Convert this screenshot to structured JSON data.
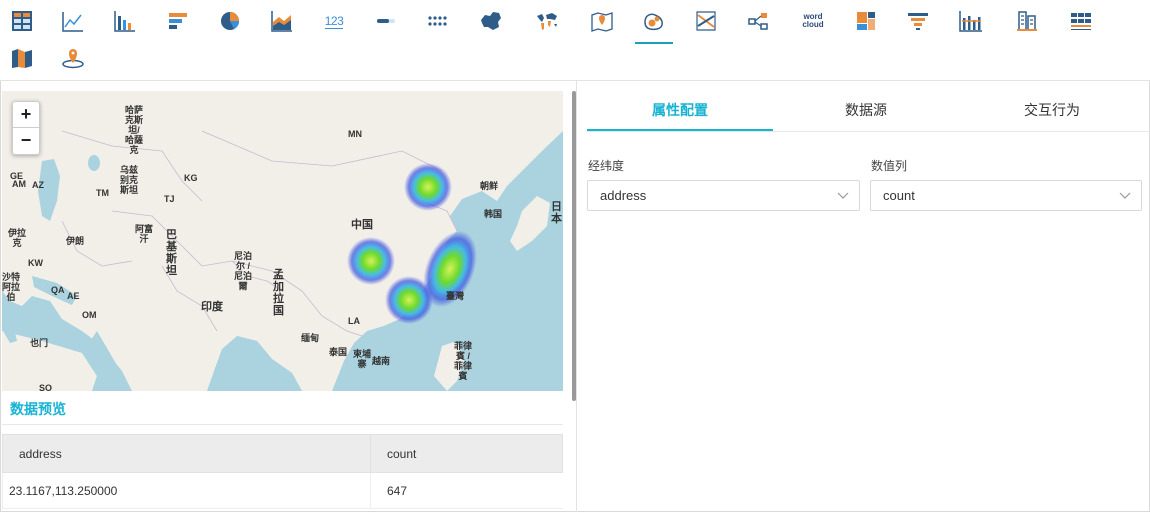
{
  "toolbar": {
    "icons": [
      "table-icon",
      "line-chart-icon",
      "bar-chart-icon",
      "horizontal-bar-icon",
      "pie-chart-icon",
      "area-chart-icon",
      "number-card-icon",
      "progress-bar-icon",
      "dots-list-icon",
      "china-map-icon",
      "world-map-icon",
      "location-map-icon",
      "heatmap-icon",
      "flow-map-icon",
      "relation-icon",
      "word-cloud-icon",
      "treemap-icon",
      "funnel-icon",
      "bar-line-icon",
      "building-icon",
      "pivot-table-icon",
      "color-map-icon",
      "pin-map-icon"
    ],
    "number_card_label": "123",
    "word_cloud_label": "word\ncloud",
    "active": "heatmap-icon"
  },
  "map": {
    "zoom_in": "+",
    "zoom_out": "−",
    "labels": {
      "kz": "哈萨\n克斯\n坦/\n哈薩\n克",
      "mn": "MN",
      "uz": "乌兹\n别克\n斯坦",
      "kg": "KG",
      "tj": "TJ",
      "tm": "TM",
      "ge": "GE",
      "am": "AM",
      "az": "AZ",
      "iraq": "伊拉\n克",
      "iran": "伊朗",
      "af": "阿富\n汗",
      "pk": "巴\n基\n斯\n坦",
      "cn": "中国",
      "kp": "朝鲜",
      "kr": "韩国",
      "jp": "日\n本",
      "np": "尼泊\n尔 /\n尼泊\n爾",
      "bd": "孟\n加\n拉\n国",
      "in": "印度",
      "kw": "KW",
      "sa": "沙特\n阿拉\n伯",
      "qa": "QA",
      "ae": "AE",
      "om": "OM",
      "la": "LA",
      "mm": "缅甸",
      "th": "泰国",
      "kh": "柬埔\n寨",
      "vn": "越南",
      "ph": "菲律\n賓 /\n菲律\n賓",
      "tw": "臺灣",
      "ye": "也门",
      "so": "SO"
    }
  },
  "preview": {
    "title": "数据预览",
    "columns": [
      "address",
      "count"
    ],
    "rows": [
      [
        "23.1167,113.250000",
        "647"
      ]
    ]
  },
  "tabs": [
    {
      "label": "属性配置",
      "active": true
    },
    {
      "label": "数据源",
      "active": false
    },
    {
      "label": "交互行为",
      "active": false
    }
  ],
  "fields": {
    "latlng_label": "经纬度",
    "latlng_value": "address",
    "value_label": "数值列",
    "value_value": "count"
  },
  "colors": {
    "accent": "#18b3d3",
    "map_water": "#aad3df",
    "map_land": "#f2efe9"
  }
}
